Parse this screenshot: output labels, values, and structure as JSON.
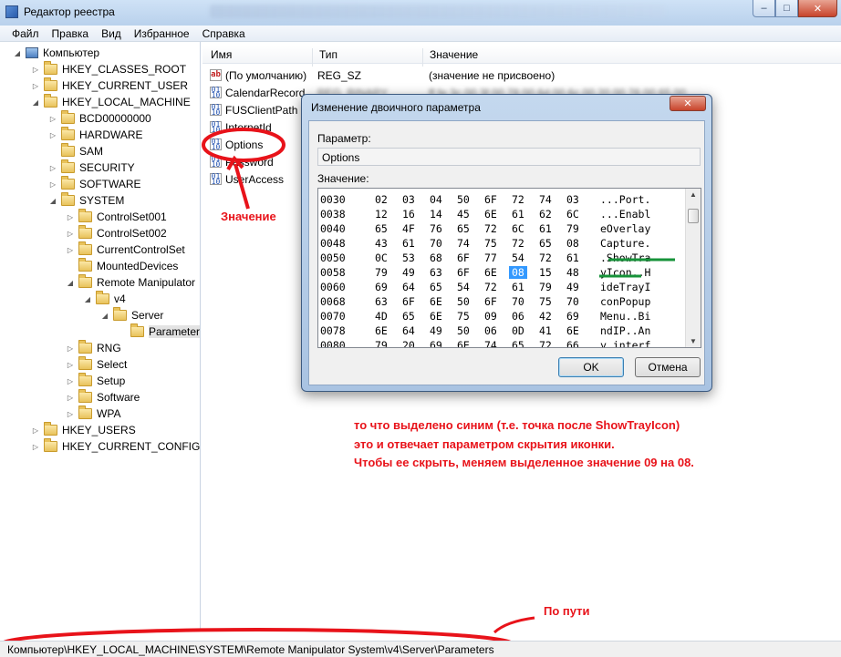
{
  "window": {
    "title": "Редактор реестра",
    "minimize": "–",
    "maximize": "□",
    "close": "✕"
  },
  "menu": [
    "Файл",
    "Правка",
    "Вид",
    "Избранное",
    "Справка"
  ],
  "tree": {
    "root": "Компьютер",
    "items": [
      "HKEY_CLASSES_ROOT",
      "HKEY_CURRENT_USER",
      "HKEY_LOCAL_MACHINE",
      "BCD00000000",
      "HARDWARE",
      "SAM",
      "SECURITY",
      "SOFTWARE",
      "SYSTEM",
      "ControlSet001",
      "ControlSet002",
      "CurrentControlSet",
      "MountedDevices",
      "Remote Manipulator",
      "v4",
      "Server",
      "Parameters",
      "RNG",
      "Select",
      "Setup",
      "Software",
      "WPA",
      "HKEY_USERS",
      "HKEY_CURRENT_CONFIG"
    ]
  },
  "list": {
    "columns": [
      "Имя",
      "Тип",
      "Значение"
    ],
    "rows": [
      {
        "name": "(По умолчанию)",
        "type": "REG_SZ",
        "value": "(значение не присвоено)"
      },
      {
        "name": "CalendarRecord",
        "type": "REG_BINARY",
        "value": "ff fe 3c 00 3f 00 78 00 6d 00 6c 00 20 00 76 00 65 00"
      },
      {
        "name": "FUSClientPath",
        "type": "",
        "value": ""
      },
      {
        "name": "InternetId",
        "type": "",
        "value": ""
      },
      {
        "name": "Options",
        "type": "",
        "value": ""
      },
      {
        "name": "Password",
        "type": "",
        "value": ""
      },
      {
        "name": "UserAccess",
        "type": "",
        "value": ""
      }
    ]
  },
  "dialog": {
    "title": "Изменение двоичного параметра",
    "param_label": "Параметр:",
    "param_value": "Options",
    "value_label": "Значение:",
    "hex_rows": [
      {
        "addr": "0030",
        "bytes": [
          "02",
          "03",
          "04",
          "50",
          "6F",
          "72",
          "74",
          "03"
        ],
        "ascii": "...Port."
      },
      {
        "addr": "0038",
        "bytes": [
          "12",
          "16",
          "14",
          "45",
          "6E",
          "61",
          "62",
          "6C"
        ],
        "ascii": "...Enabl"
      },
      {
        "addr": "0040",
        "bytes": [
          "65",
          "4F",
          "76",
          "65",
          "72",
          "6C",
          "61",
          "79"
        ],
        "ascii": "eOverlay"
      },
      {
        "addr": "0048",
        "bytes": [
          "43",
          "61",
          "70",
          "74",
          "75",
          "72",
          "65",
          "08"
        ],
        "ascii": "Capture."
      },
      {
        "addr": "0050",
        "bytes": [
          "0C",
          "53",
          "68",
          "6F",
          "77",
          "54",
          "72",
          "61"
        ],
        "ascii": ".ShowTra"
      },
      {
        "addr": "0058",
        "bytes": [
          "79",
          "49",
          "63",
          "6F",
          "6E",
          "08",
          "15",
          "48"
        ],
        "ascii": "yIcon..H",
        "selected_byte": 5
      },
      {
        "addr": "0060",
        "bytes": [
          "69",
          "64",
          "65",
          "54",
          "72",
          "61",
          "79",
          "49"
        ],
        "ascii": "ideTrayI"
      },
      {
        "addr": "0068",
        "bytes": [
          "63",
          "6F",
          "6E",
          "50",
          "6F",
          "70",
          "75",
          "70"
        ],
        "ascii": "conPopup"
      },
      {
        "addr": "0070",
        "bytes": [
          "4D",
          "65",
          "6E",
          "75",
          "09",
          "06",
          "42",
          "69"
        ],
        "ascii": "Menu..Bi"
      },
      {
        "addr": "0078",
        "bytes": [
          "6E",
          "64",
          "49",
          "50",
          "06",
          "0D",
          "41",
          "6E"
        ],
        "ascii": "ndIP..An"
      },
      {
        "addr": "0080",
        "bytes": [
          "79",
          "20",
          "69",
          "6E",
          "74",
          "65",
          "72",
          "66"
        ],
        "ascii": "y interf"
      }
    ],
    "ok": "OK",
    "cancel": "Отмена"
  },
  "annotations": {
    "value_label": "Значение",
    "note_line1": "то что выделено синим (т.е. точка после ShowTrayIcon)",
    "note_line2": "это и отвечает параметром скрытия иконки.",
    "note_line3": "Чтобы ее скрыть, меняем выделенное значение 09 на 08.",
    "path_label": "По пути",
    "color": "#e8131a"
  },
  "status": {
    "path": "Компьютер\\HKEY_LOCAL_MACHINE\\SYSTEM\\Remote Manipulator System\\v4\\Server\\Parameters"
  }
}
